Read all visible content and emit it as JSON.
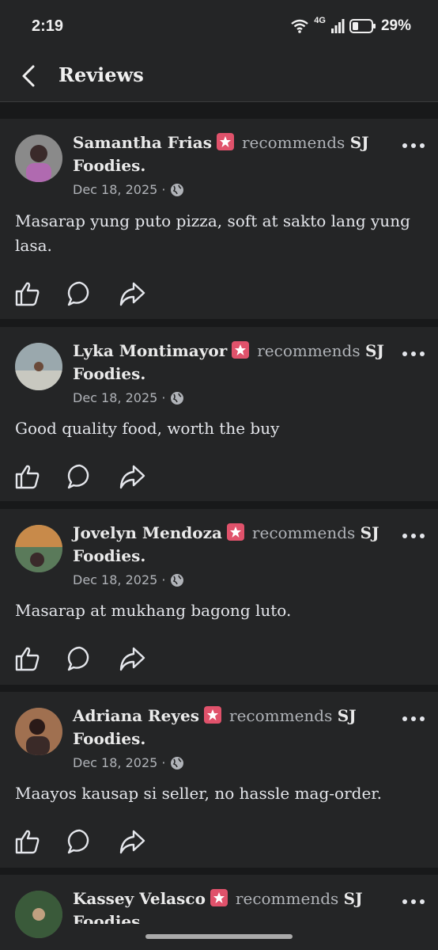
{
  "status": {
    "time": "2:19",
    "network": "4G",
    "battery": "29%"
  },
  "header": {
    "title": "Reviews"
  },
  "reviews": [
    {
      "name": "Samantha Frias",
      "recommends": "recommends",
      "page_part1": "SJ",
      "page_part2": "Foodies.",
      "date": "Dec 18, 2025 ·",
      "text": "Masarap yung puto pizza, soft at sakto lang yung lasa.",
      "avatar_color": "#6b5a6e"
    },
    {
      "name": "Lyka Montimayor",
      "recommends": "recommends",
      "page_part1": "SJ",
      "page_part2": "Foodies.",
      "date": "Dec 18, 2025 ·",
      "text": "Good quality food, worth the buy",
      "avatar_color": "#7a8a8c"
    },
    {
      "name": "Jovelyn Mendoza",
      "recommends": "recommends",
      "page_part1": "SJ",
      "page_part2": "Foodies.",
      "date": "Dec 18, 2025 ·",
      "text": "Masarap at mukhang bagong luto.",
      "avatar_color": "#8a5a3a"
    },
    {
      "name": "Adriana Reyes",
      "recommends": "recommends",
      "page_part1": "SJ",
      "page_part2": "Foodies.",
      "date": "Dec 18, 2025 ·",
      "text": "Maayos kausap si seller, no hassle mag-order.",
      "avatar_color": "#5a4038"
    },
    {
      "name": "Kassey Velasco",
      "recommends": "recommends",
      "page_part1": "SJ",
      "page_part2": "Foodies",
      "date": "",
      "text": "",
      "avatar_color": "#4a6a4a"
    }
  ]
}
